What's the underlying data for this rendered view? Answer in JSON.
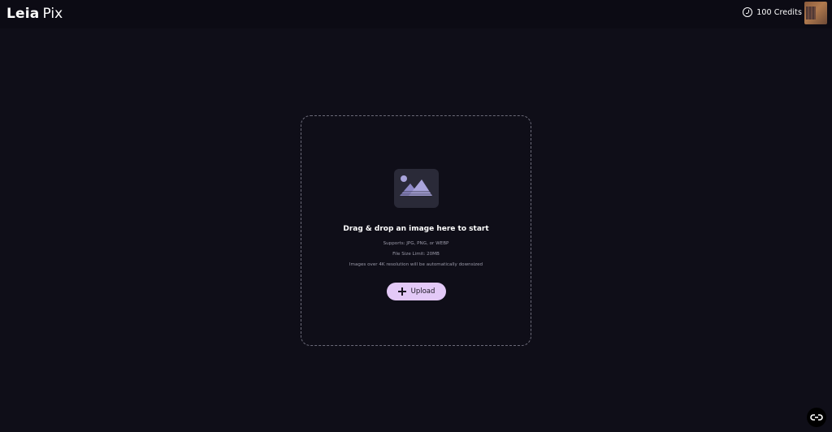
{
  "header": {
    "logo_primary": "Leia",
    "logo_secondary": "Pix",
    "credits_label": "100  Credits",
    "credits_icon": "credits-coin-icon",
    "avatar_icon": "user-avatar"
  },
  "dropzone": {
    "image_icon": "image-placeholder-icon",
    "headline": "Drag & drop an image here to start",
    "supports": "Supports: JPG, PNG, or WEBP",
    "size_limit": "File Size Limit: 20MB",
    "resolution_note": "Images over 4K resolution will be automatically downsized",
    "upload_label": "Upload",
    "upload_icon": "plus-icon"
  },
  "floating": {
    "chat_icon": "link-icon"
  },
  "colors": {
    "background": "#0f0e18",
    "topbar": "#0c0b14",
    "accent": "#e3c9f7",
    "muted_text": "#9a99a8",
    "dashed_border": "#6b6a78"
  }
}
